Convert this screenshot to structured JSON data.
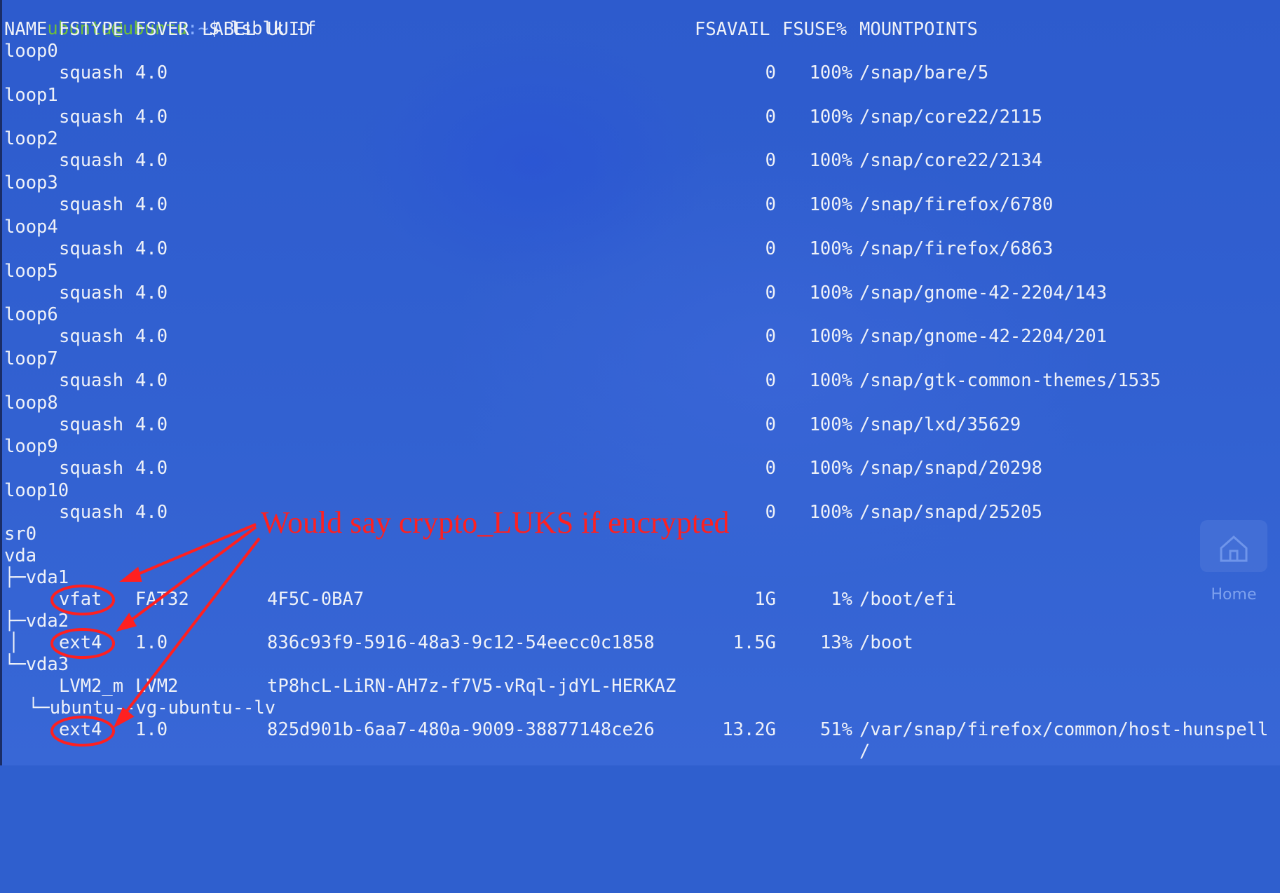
{
  "prompt": {
    "user": "ubuntu@ubuntu",
    "path": ":~",
    "symbol": "$",
    "command": "lsblk -f"
  },
  "table": {
    "headers": {
      "name": "NAME",
      "fstype": "FSTYPE",
      "fsver": "FSVER",
      "label": "LABEL",
      "uuid": "UUID",
      "fsavail": "FSAVAIL",
      "fsuse": "FSUSE%",
      "mountpoints": "MOUNTPOINTS"
    },
    "loops": [
      {
        "name": "loop0",
        "fstype": "squash",
        "fsver": "4.0",
        "avail": "0",
        "use": "100%",
        "mount": "/snap/bare/5"
      },
      {
        "name": "loop1",
        "fstype": "squash",
        "fsver": "4.0",
        "avail": "0",
        "use": "100%",
        "mount": "/snap/core22/2115"
      },
      {
        "name": "loop2",
        "fstype": "squash",
        "fsver": "4.0",
        "avail": "0",
        "use": "100%",
        "mount": "/snap/core22/2134"
      },
      {
        "name": "loop3",
        "fstype": "squash",
        "fsver": "4.0",
        "avail": "0",
        "use": "100%",
        "mount": "/snap/firefox/6780"
      },
      {
        "name": "loop4",
        "fstype": "squash",
        "fsver": "4.0",
        "avail": "0",
        "use": "100%",
        "mount": "/snap/firefox/6863"
      },
      {
        "name": "loop5",
        "fstype": "squash",
        "fsver": "4.0",
        "avail": "0",
        "use": "100%",
        "mount": "/snap/gnome-42-2204/143"
      },
      {
        "name": "loop6",
        "fstype": "squash",
        "fsver": "4.0",
        "avail": "0",
        "use": "100%",
        "mount": "/snap/gnome-42-2204/201"
      },
      {
        "name": "loop7",
        "fstype": "squash",
        "fsver": "4.0",
        "avail": "0",
        "use": "100%",
        "mount": "/snap/gtk-common-themes/1535"
      },
      {
        "name": "loop8",
        "fstype": "squash",
        "fsver": "4.0",
        "avail": "0",
        "use": "100%",
        "mount": "/snap/lxd/35629"
      },
      {
        "name": "loop9",
        "fstype": "squash",
        "fsver": "4.0",
        "avail": "0",
        "use": "100%",
        "mount": "/snap/snapd/20298"
      },
      {
        "name": "loop10",
        "fstype": "squash",
        "fsver": "4.0",
        "avail": "0",
        "use": "100%",
        "mount": "/snap/snapd/25205"
      }
    ],
    "sr0": "sr0",
    "vda": "vda",
    "vda1": {
      "name": "├─vda1",
      "fstype": "vfat",
      "fsver": "FAT32",
      "uuid": "4F5C-0BA7",
      "avail": "1G",
      "use": "1%",
      "mount": "/boot/efi"
    },
    "vda2": {
      "name": "├─vda2",
      "fstype": "ext4",
      "fsver": "1.0",
      "uuid": "836c93f9-5916-48a3-9c12-54eecc0c1858",
      "avail": "1.5G",
      "use": "13%",
      "mount": "/boot"
    },
    "vda3": {
      "name": "└─vda3",
      "fstype": "LVM2_m",
      "fsver": "LVM2",
      "uuid": "tP8hcL-LiRN-AH7z-f7V5-vRql-jdYL-HERKAZ"
    },
    "lv": {
      "name": "└─ubuntu--vg-ubuntu--lv",
      "fstype": "ext4",
      "fsver": "1.0",
      "uuid": "825d901b-6aa7-480a-9009-38877148ce26",
      "avail": "13.2G",
      "use": "51%",
      "mount": "/var/snap/firefox/common/host-hunspell",
      "mount2": "/"
    }
  },
  "annotation": {
    "text": "Would say crypto_LUKS if encrypted",
    "color": "#ff2020"
  },
  "desktop": {
    "home_label": "Home",
    "home_icon": "home-icon"
  },
  "colors": {
    "background": "#2f5fce",
    "text": "#eef1f8",
    "prompt_user": "#6fbf3a"
  }
}
